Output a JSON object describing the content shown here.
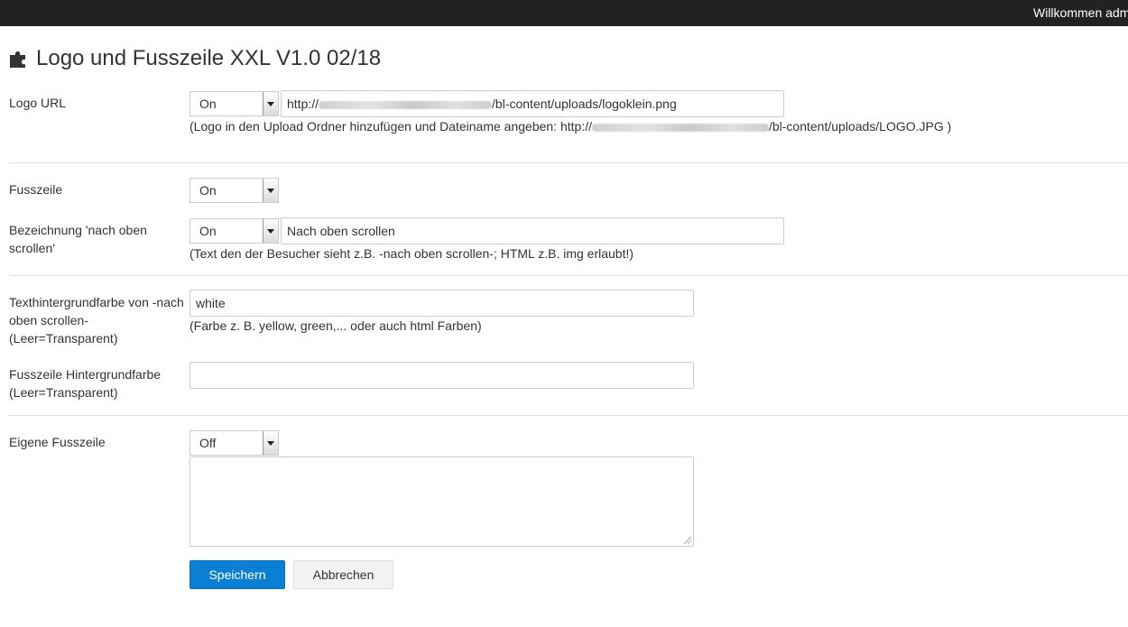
{
  "topbar": {
    "welcome": "Willkommen adm"
  },
  "page": {
    "title": "Logo und Fusszeile XXL V1.0 02/18"
  },
  "form": {
    "logo_url": {
      "label": "Logo URL",
      "select_value": "On",
      "input_prefix": "http://",
      "input_suffix": "/bl-content/uploads/logoklein.png",
      "help_prefix": "(Logo in den Upload Ordner hinzufügen und Dateiname angeben: http://",
      "help_suffix": "/bl-content/uploads/LOGO.JPG )"
    },
    "fusszeile": {
      "label": "Fusszeile",
      "select_value": "On"
    },
    "nach_oben": {
      "label_line1": "Bezeichnung 'nach oben",
      "label_line2": "scrollen'",
      "select_value": "On",
      "input_value": "Nach oben scrollen",
      "help": "(Text den der Besucher sieht z.B. -nach oben scrollen-; HTML z.B. img erlaubt!)"
    },
    "text_bg": {
      "label_line1": "Texthintergrundfarbe von -nach",
      "label_line2": "oben scrollen-",
      "label_line3": "(Leer=Transparent)",
      "input_value": "white",
      "help": "(Farbe z. B. yellow, green,... oder auch html Farben)"
    },
    "footer_bg": {
      "label_line1": "Fusszeile Hintergrundfarbe",
      "label_line2": "(Leer=Transparent)",
      "input_value": ""
    },
    "custom_footer": {
      "label": "Eigene Fusszeile",
      "select_value": "Off",
      "textarea_value": ""
    }
  },
  "buttons": {
    "save": "Speichern",
    "cancel": "Abbrechen"
  },
  "colors": {
    "primary": "#0a7fd4",
    "topbar": "#222222"
  },
  "icons": {
    "title": "puzzle-icon"
  }
}
